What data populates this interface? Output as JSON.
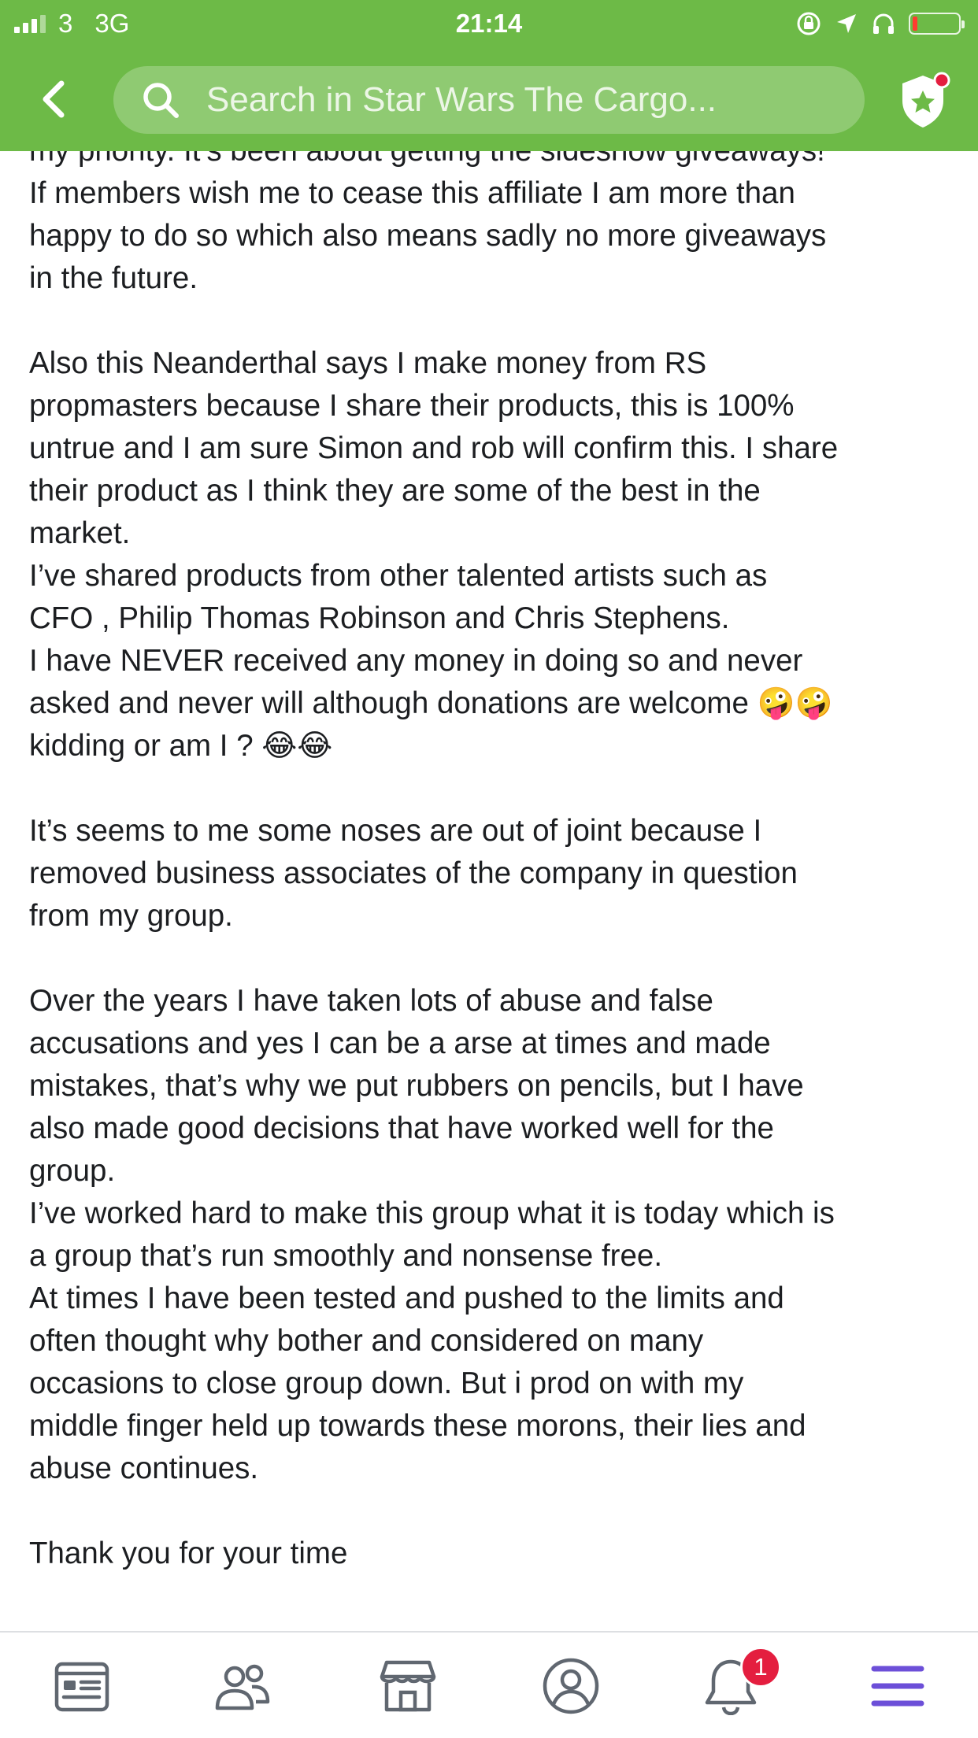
{
  "status_bar": {
    "signal_bars": "signal-bars-icon",
    "carrier": "3",
    "network": "3G",
    "time": "21:14",
    "icons": [
      "orientation-lock-icon",
      "location-arrow-icon",
      "headphones-icon",
      "battery-icon"
    ],
    "battery_level": 0.1,
    "battery_color": "#ff3b30"
  },
  "header": {
    "search_placeholder": "Search in Star Wars The Cargo...",
    "background_color": "#6dba47",
    "search_pill_color": "#8fca72"
  },
  "post": {
    "body": "my priority. It’s been about getting the sideshow giveaways!\nIf members wish me to cease this affiliate I am more than\nhappy to do so which also means sadly no more giveaways\nin the future.\n\nAlso this Neanderthal  says I make money from RS\npropmasters because I share their products, this is 100%\nuntrue and I am sure Simon and rob will confirm this. I share\ntheir product as I think they are some of the best in the\nmarket.\nI’ve shared products from other talented artists such as\nCFO , Philip Thomas Robinson and Chris Stephens.\nI have NEVER received any money in doing so and never\nasked and never will although donations are welcome 🤪🤪\nkidding or am I ? 😂😂\n\nIt’s seems to me some noses are out of joint because I\nremoved business associates of the company in question\nfrom my group.\n\nOver the years I have taken lots of abuse and false\naccusations and yes I can be a arse at times and made\nmistakes, that’s why we put rubbers on pencils, but I have\nalso made good decisions that have worked well for the\ngroup.\nI’ve worked hard to make this group what it is today which is\na group that’s run smoothly and nonsense free.\nAt times I have been tested and pushed to the limits and\noften thought why bother and considered on many\noccasions to close group down. But i prod on with my\nmiddle finger held up towards these morons, their lies and\nabuse continues.\n\nThank you for your time"
  },
  "tab_bar": {
    "tabs": [
      {
        "icon": "news-feed-icon"
      },
      {
        "icon": "groups-icon"
      },
      {
        "icon": "marketplace-icon"
      },
      {
        "icon": "profile-icon"
      },
      {
        "icon": "notifications-bell-icon",
        "badge": "1"
      },
      {
        "icon": "menu-icon",
        "active": true
      }
    ],
    "icon_color": "#606770",
    "active_color": "#6c4fd8",
    "badge_color": "#e41e3f"
  }
}
